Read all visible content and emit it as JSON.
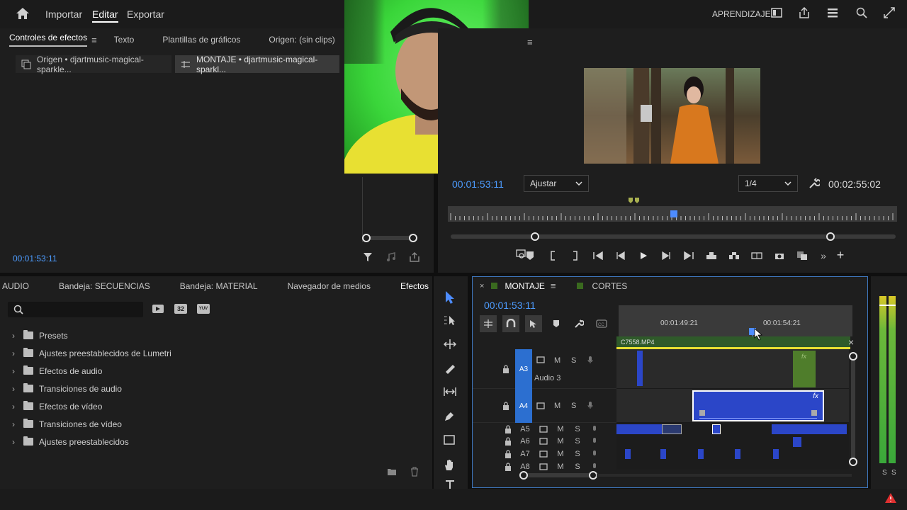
{
  "topbar": {
    "nav": [
      "Importar",
      "Editar",
      "Exportar"
    ],
    "active_nav": "Editar",
    "right_label": "APRENDIZAJE"
  },
  "effect_controls": {
    "tabs": [
      "Controles de efectos",
      "Texto",
      "Plantillas de gráficos",
      "Origen: (sin clips)"
    ],
    "source_tabs": [
      "Origen • djartmusic-magical-sparkle...",
      "MONTAJE • djartmusic-magical-sparkl..."
    ],
    "timecode": "00:01:53:11"
  },
  "program_monitor": {
    "timecode": "00:01:53:11",
    "fit": "Ajustar",
    "resolution": "1/4",
    "duration": "00:02:55:02"
  },
  "project_panel": {
    "tabs": [
      "AUDIO",
      "Bandeja: SECUENCIAS",
      "Bandeja: MATERIAL",
      "Navegador de medios",
      "Efectos"
    ],
    "active_tab": "Efectos",
    "search_placeholder": "",
    "tree": [
      {
        "label": "Presets",
        "icon": "star-folder-icon"
      },
      {
        "label": "Ajustes preestablecidos de Lumetri",
        "icon": "star-folder-icon"
      },
      {
        "label": "Efectos de audio",
        "icon": "folder-icon"
      },
      {
        "label": "Transiciones de audio",
        "icon": "folder-icon"
      },
      {
        "label": "Efectos de vídeo",
        "icon": "folder-icon"
      },
      {
        "label": "Transiciones de vídeo",
        "icon": "folder-icon"
      },
      {
        "label": "Ajustes preestablecidos",
        "icon": "star-folder-icon"
      }
    ],
    "badge_32": "32",
    "badge_yuv": "YUV"
  },
  "timeline": {
    "tabs": [
      "MONTAJE",
      "CORTES"
    ],
    "timecode": "00:01:53:11",
    "ruler": [
      "00:01:49:21",
      "00:01:54:21"
    ],
    "v1_clip": "C7558.MP4",
    "tracks": [
      {
        "id": "A3",
        "name": "Audio 3",
        "m": "M",
        "s": "S"
      },
      {
        "id": "A4",
        "name": "",
        "m": "M",
        "s": "S"
      },
      {
        "id": "A5",
        "name": "",
        "m": "M",
        "s": "S"
      },
      {
        "id": "A6",
        "name": "",
        "m": "M",
        "s": "S"
      },
      {
        "id": "A7",
        "name": "",
        "m": "M",
        "s": "S"
      },
      {
        "id": "A8",
        "name": "",
        "m": "M",
        "s": "S"
      }
    ],
    "fx": "fx"
  },
  "meter": {
    "labels": [
      "S",
      "S"
    ]
  },
  "colors": {
    "accent_blue": "#2c6fd0",
    "timecode_blue": "#4d9cff",
    "webcam_green": "#3ad63a"
  }
}
